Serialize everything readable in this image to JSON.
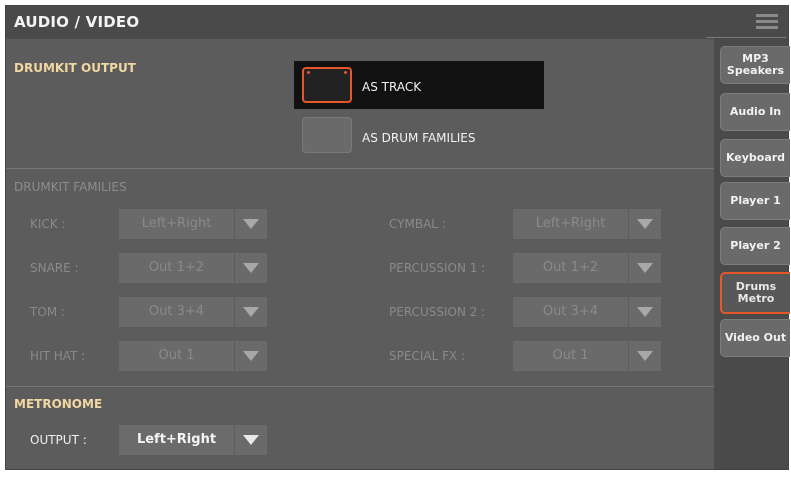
{
  "window": {
    "title": "AUDIO / VIDEO"
  },
  "drumkit_output": {
    "label": "DRUMKIT OUTPUT",
    "options": [
      {
        "label": "AS TRACK",
        "selected": true
      },
      {
        "label": "AS DRUM FAMILIES",
        "selected": false
      }
    ]
  },
  "drumkit_families": {
    "label": "DRUMKIT FAMILIES",
    "enabled": false,
    "left": [
      {
        "label": "KICK :",
        "value": "Left+Right"
      },
      {
        "label": "SNARE :",
        "value": "Out 1+2"
      },
      {
        "label": "TOM :",
        "value": "Out 3+4"
      },
      {
        "label": "HIT HAT :",
        "value": "Out 1"
      }
    ],
    "right": [
      {
        "label": "CYMBAL :",
        "value": "Left+Right"
      },
      {
        "label": "PERCUSSION 1 :",
        "value": "Out 1+2"
      },
      {
        "label": "PERCUSSION 2 :",
        "value": "Out 3+4"
      },
      {
        "label": "SPECIAL FX :",
        "value": "Out 1"
      }
    ]
  },
  "metronome": {
    "label": "METRONOME",
    "output_label": "OUTPUT :",
    "output_value": "Left+Right"
  },
  "sidebar": {
    "tabs": [
      {
        "label": "MP3 Speakers",
        "active": false
      },
      {
        "label": "Audio In",
        "active": false
      },
      {
        "label": "Keyboard",
        "active": false
      },
      {
        "label": "Player 1",
        "active": false
      },
      {
        "label": "Player 2",
        "active": false
      },
      {
        "label": "Drums Metro",
        "active": true
      },
      {
        "label": "Video Out",
        "active": false
      }
    ]
  },
  "colors": {
    "accent": "#e6582a",
    "section_label": "#f1d7a1",
    "background": "#5c5c5c"
  },
  "icons": {
    "menu": "menu-icon",
    "dropdown": "chevron-down-icon"
  }
}
